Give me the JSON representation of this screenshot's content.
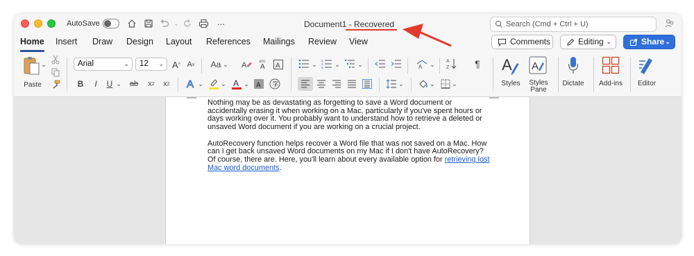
{
  "titlebar": {
    "autosave_label": "AutoSave",
    "doc_name": "Document1",
    "doc_separator": " - ",
    "doc_status": "Recovered",
    "search_placeholder": "Search (Cmd + Ctrl + U)"
  },
  "tabs": [
    "Home",
    "Insert",
    "Draw",
    "Design",
    "Layout",
    "References",
    "Mailings",
    "Review",
    "View"
  ],
  "actions": {
    "comments": "Comments",
    "editing": "Editing",
    "share": "Share"
  },
  "ribbon": {
    "paste": "Paste",
    "font_name": "Arial",
    "font_size": "12",
    "styles": "Styles",
    "styles_pane_1": "Styles",
    "styles_pane_2": "Pane",
    "dictate": "Dictate",
    "addins": "Add-ins",
    "editor": "Editor"
  },
  "document": {
    "para1": "Nothing may be as devastating as forgetting to save a Word document or accidentally erasing it when working on a Mac, particularly if you've spent hours or days working over it. You probably want to understand how to retrieve a deleted or unsaved Word document if you are working on a crucial project.",
    "para2_text": "AutoRecovery function helps recover a Word file that was not saved on a Mac. How can I get back unsaved Word documents on my Mac if I don't have AutoRecovery? Of course, there are. Here, you'll learn about every available option for ",
    "para2_link": "retrieving lost Mac word documents",
    "para2_end": "."
  },
  "colors": {
    "accent": "#2f6fdb",
    "annotation": "#e23b2e",
    "link": "#1a5ccc"
  },
  "icons": [
    "close-icon",
    "minimize-icon",
    "zoom-icon",
    "home-icon",
    "save-icon",
    "undo-icon",
    "redo-icon",
    "print-icon",
    "more-icon",
    "search-icon",
    "share-people-icon",
    "comment-icon",
    "pencil-icon",
    "share-icon",
    "paste-icon",
    "cut-icon",
    "copy-icon",
    "format-painter-icon",
    "bold-icon",
    "italic-icon",
    "underline-icon",
    "strikethrough-icon",
    "subscript-icon",
    "superscript-icon",
    "text-effects-icon",
    "highlight-icon",
    "font-color-icon",
    "shading-icon",
    "bullets-icon",
    "numbering-icon",
    "multilevel-icon",
    "decrease-indent-icon",
    "increase-indent-icon",
    "sort-icon",
    "pilcrow-icon",
    "align-left-icon",
    "align-center-icon",
    "align-right-icon",
    "justify-icon",
    "line-spacing-icon",
    "fill-icon",
    "borders-icon",
    "styles-icon",
    "styles-pane-icon",
    "microphone-icon",
    "addins-icon",
    "editor-icon",
    "annotation-arrow"
  ]
}
